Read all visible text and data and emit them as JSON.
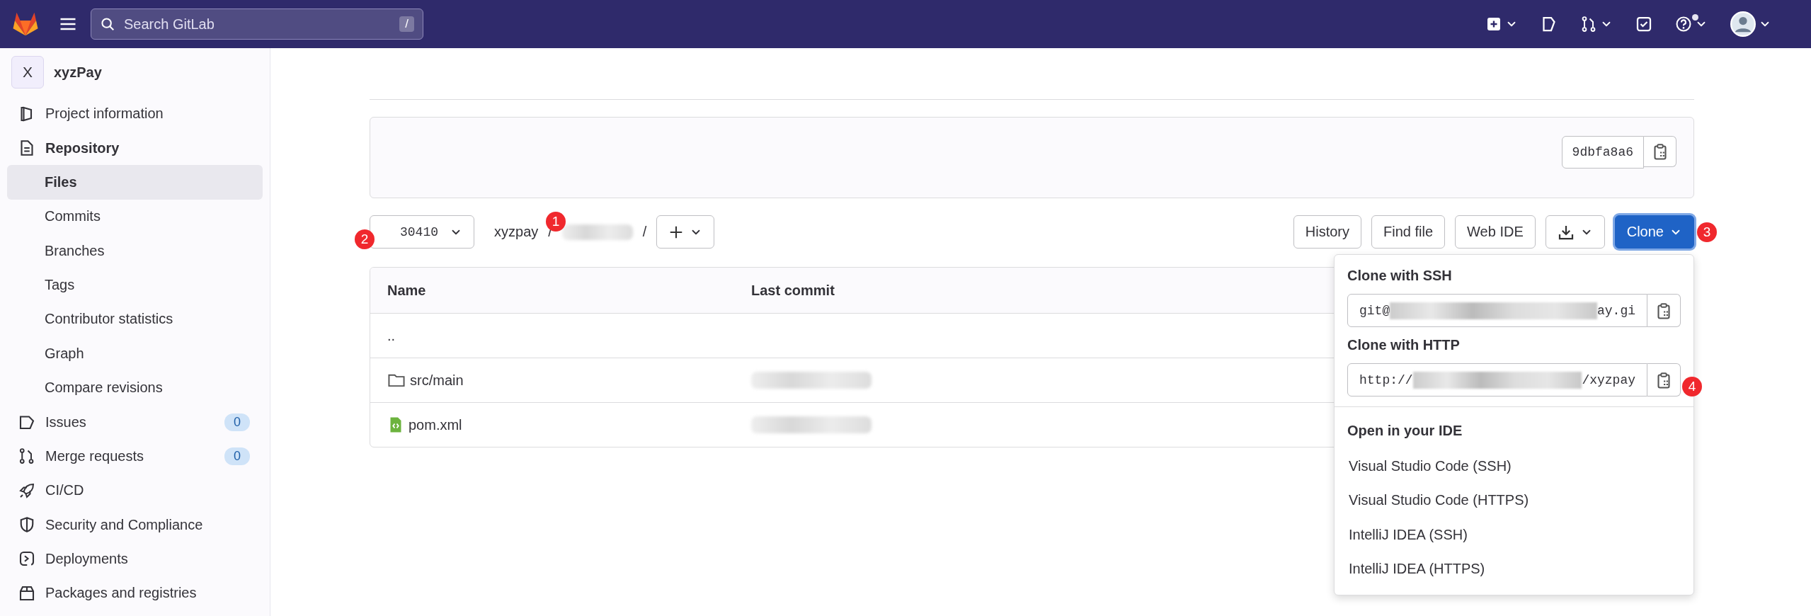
{
  "topbar": {
    "search": {
      "placeholder": "Search GitLab",
      "shortcut": "/"
    },
    "help_has_notification": true
  },
  "sidebar": {
    "project": {
      "avatar": "X",
      "name": "xyzPay"
    },
    "items": [
      {
        "label": "Project information",
        "active": false
      },
      {
        "label": "Repository",
        "active": true,
        "expanded": true,
        "children": [
          {
            "label": "Files",
            "selected": true
          },
          {
            "label": "Commits",
            "selected": false
          },
          {
            "label": "Branches",
            "selected": false
          },
          {
            "label": "Tags",
            "selected": false
          },
          {
            "label": "Contributor statistics",
            "selected": false
          },
          {
            "label": "Graph",
            "selected": false
          },
          {
            "label": "Compare revisions",
            "selected": false
          }
        ]
      },
      {
        "label": "Issues",
        "active": false,
        "count": "0"
      },
      {
        "label": "Merge requests",
        "active": false,
        "count": "0"
      },
      {
        "label": "CI/CD",
        "active": false
      },
      {
        "label": "Security and Compliance",
        "active": false
      },
      {
        "label": "Deployments",
        "active": false
      },
      {
        "label": "Packages and registries",
        "active": false
      }
    ]
  },
  "commit": {
    "sha": "9dbfa8a6"
  },
  "toolbar": {
    "branch": "30410",
    "breadcrumb": [
      {
        "text": "xyzpay",
        "redacted": false
      },
      {
        "redacted": true
      }
    ],
    "separator": "/",
    "buttons": [
      "History",
      "Find file",
      "Web IDE"
    ],
    "clone_label": "Clone",
    "clone_open": true
  },
  "table": {
    "columns": [
      "Name",
      "Last commit"
    ],
    "rows": [
      {
        "kind": "parent",
        "name": "..",
        "redacted": false
      },
      {
        "kind": "folder",
        "name": "src/main",
        "redacted": true
      },
      {
        "kind": "file",
        "name": "pom.xml",
        "redacted": true
      }
    ]
  },
  "clone_menu": {
    "sections": [
      {
        "title": "Clone with SSH",
        "start": "git@",
        "end": "ay.gi"
      },
      {
        "title": "Clone with HTTP",
        "start": "http://",
        "end": "/xyzpay"
      }
    ],
    "ide_title": "Open in your IDE",
    "ide_items": [
      "Visual Studio Code (SSH)",
      "Visual Studio Code (HTTPS)",
      "IntelliJ IDEA (SSH)",
      "IntelliJ IDEA (HTTPS)"
    ]
  },
  "annotations": [
    {
      "label": "1"
    },
    {
      "label": "2"
    },
    {
      "label": "3"
    },
    {
      "label": "4"
    }
  ]
}
